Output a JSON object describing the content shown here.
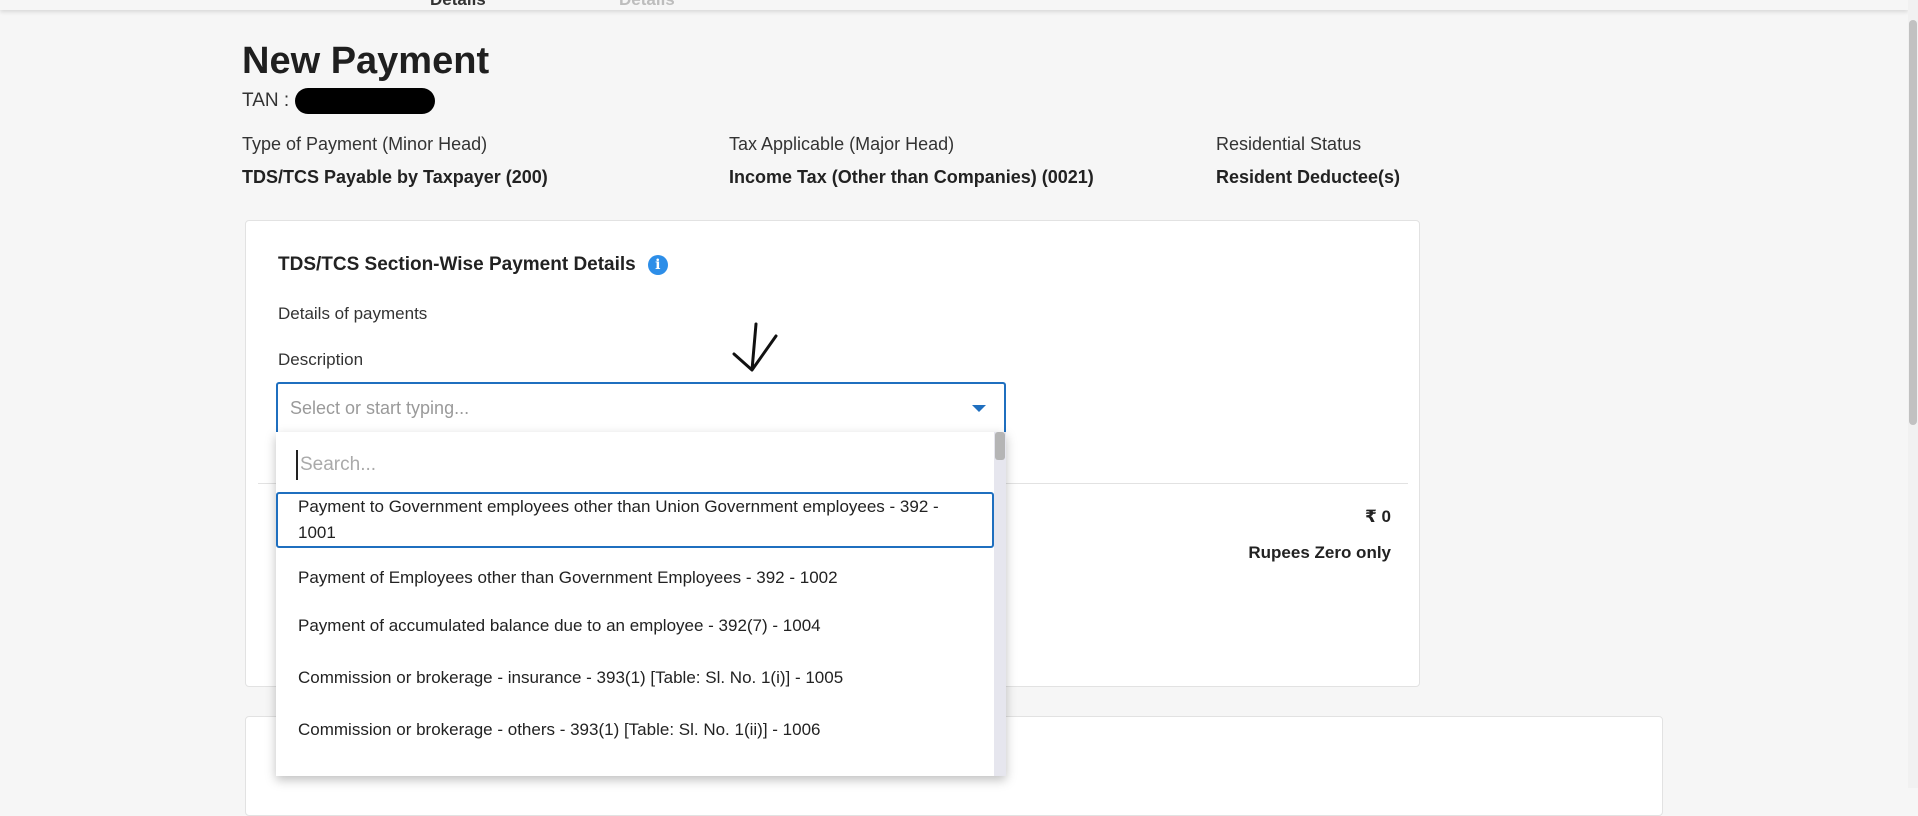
{
  "stepper": {
    "step1": "Details",
    "step2": "Details"
  },
  "page": {
    "title": "New Payment",
    "tan_label": "TAN :"
  },
  "meta": [
    {
      "label": "Type of Payment (Minor Head)",
      "value": "TDS/TCS Payable by Taxpayer (200)"
    },
    {
      "label": "Tax Applicable (Major Head)",
      "value": "Income Tax (Other than Companies) (0021)"
    },
    {
      "label": "Residential Status",
      "value": "Resident Deductee(s)"
    }
  ],
  "card": {
    "title": "TDS/TCS Section-Wise Payment Details",
    "info_icon": "i",
    "subtitle": "Details of payments",
    "description_label": "Description",
    "select_placeholder": "Select or start typing...",
    "amount": "₹ 0",
    "amount_words": "Rupees Zero only"
  },
  "dropdown": {
    "search_placeholder": "Search...",
    "items": [
      "Payment to Government employees other than Union Government employees - 392 - 1001",
      "Payment of Employees other than Government Employees - 392 - 1002",
      "Payment of accumulated balance due to an employee - 392(7) - 1004",
      "Commission or brokerage - insurance - 393(1) [Table: Sl. No. 1(i)] - 1005",
      "Commission or brokerage - others - 393(1) [Table: Sl. No. 1(ii)] - 1006"
    ]
  },
  "colors": {
    "accent": "#1f6fbf",
    "info": "#2d8ee8",
    "background": "#f6f6f6"
  }
}
